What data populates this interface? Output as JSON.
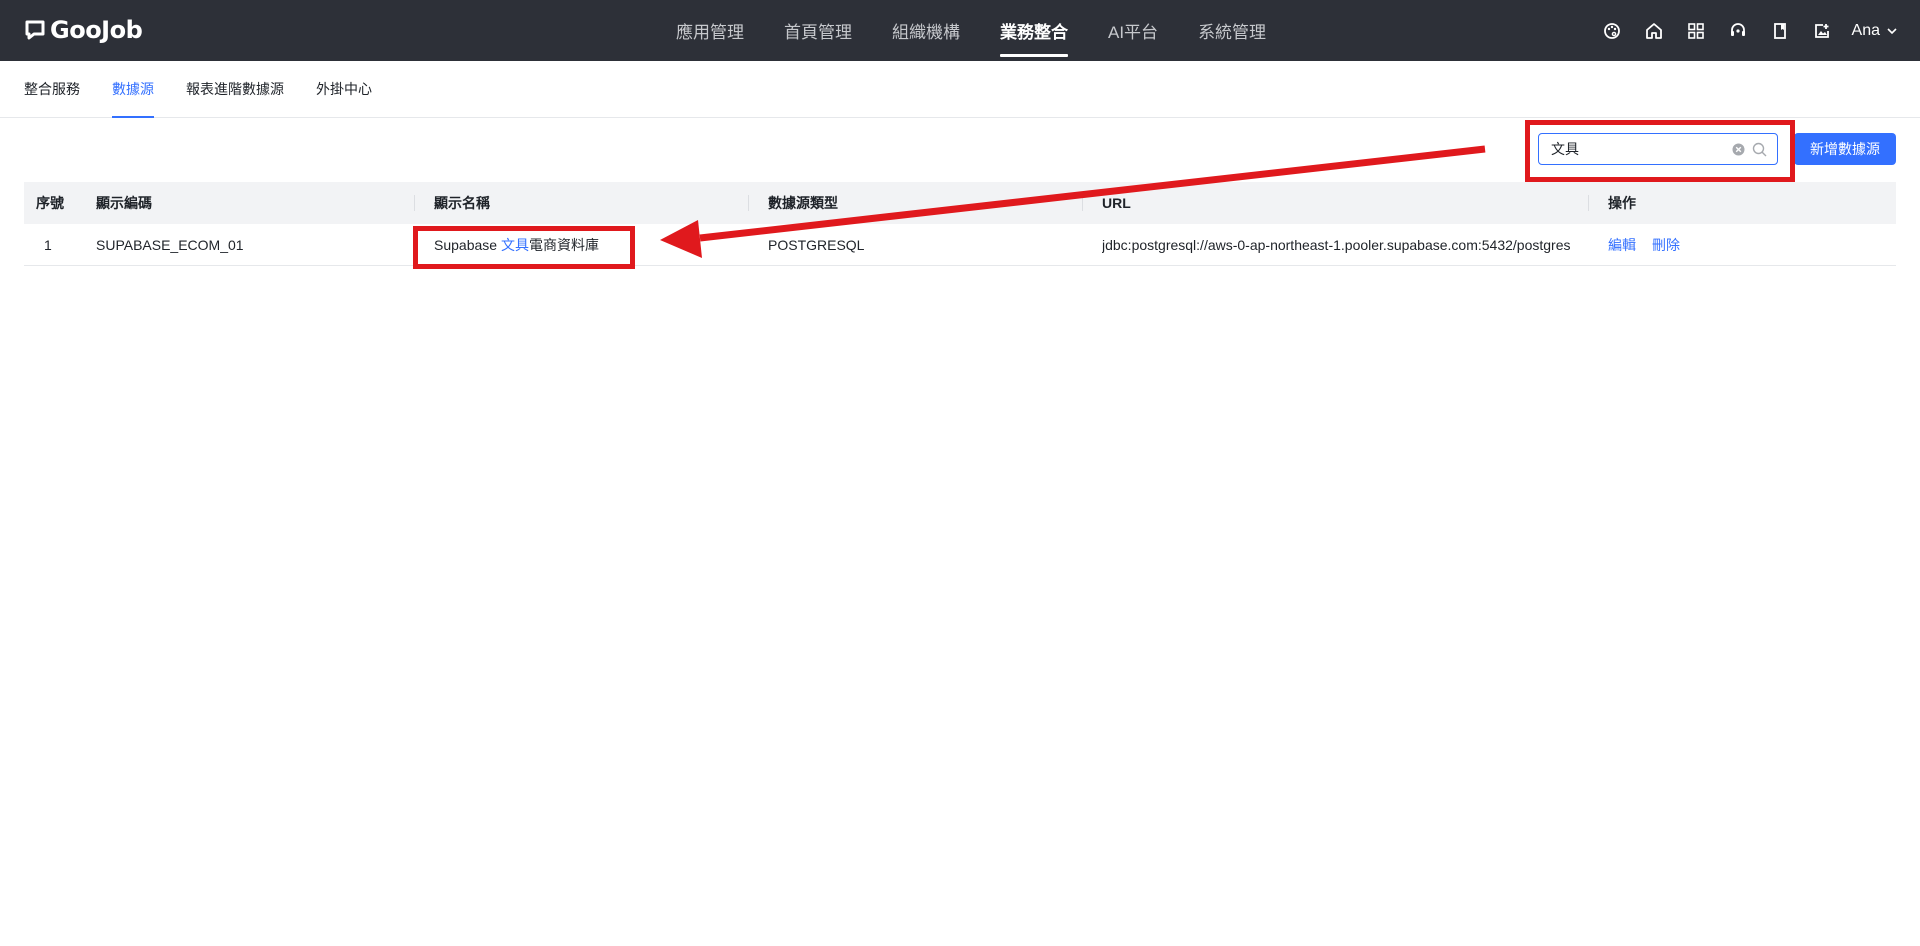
{
  "header": {
    "logo_text": "GooJob",
    "nav": [
      {
        "label": "應用管理",
        "active": false
      },
      {
        "label": "首頁管理",
        "active": false
      },
      {
        "label": "組織機構",
        "active": false
      },
      {
        "label": "業務整合",
        "active": true
      },
      {
        "label": "AI平台",
        "active": false
      },
      {
        "label": "系統管理",
        "active": false
      }
    ],
    "icons": [
      "palette-icon",
      "home-icon",
      "apps-grid-icon",
      "support-icon",
      "book-icon",
      "image-edit-icon"
    ],
    "user_name": "Ana"
  },
  "subtabs": [
    {
      "label": "整合服務",
      "active": false
    },
    {
      "label": "數據源",
      "active": true
    },
    {
      "label": "報表進階數據源",
      "active": false
    },
    {
      "label": "外掛中心",
      "active": false
    }
  ],
  "toolbar": {
    "search_value": "文具",
    "add_label": "新增數據源"
  },
  "table": {
    "headers": [
      "序號",
      "顯示編碼",
      "顯示名稱",
      "數據源類型",
      "URL",
      "操作"
    ],
    "rows": [
      {
        "index": "1",
        "code": "SUPABASE_ECOM_01",
        "name_prefix": "Supabase ",
        "name_highlight": "文具",
        "name_suffix": "電商資料庫",
        "type": "POSTGRESQL",
        "url": "jdbc:postgresql://aws-0-ap-northeast-1.pooler.supabase.com:5432/postgres",
        "edit_label": "編輯",
        "delete_label": "刪除"
      }
    ]
  },
  "colors": {
    "topbar": "#2d3038",
    "accent": "#3370ff",
    "annotation": "#e0191d"
  }
}
